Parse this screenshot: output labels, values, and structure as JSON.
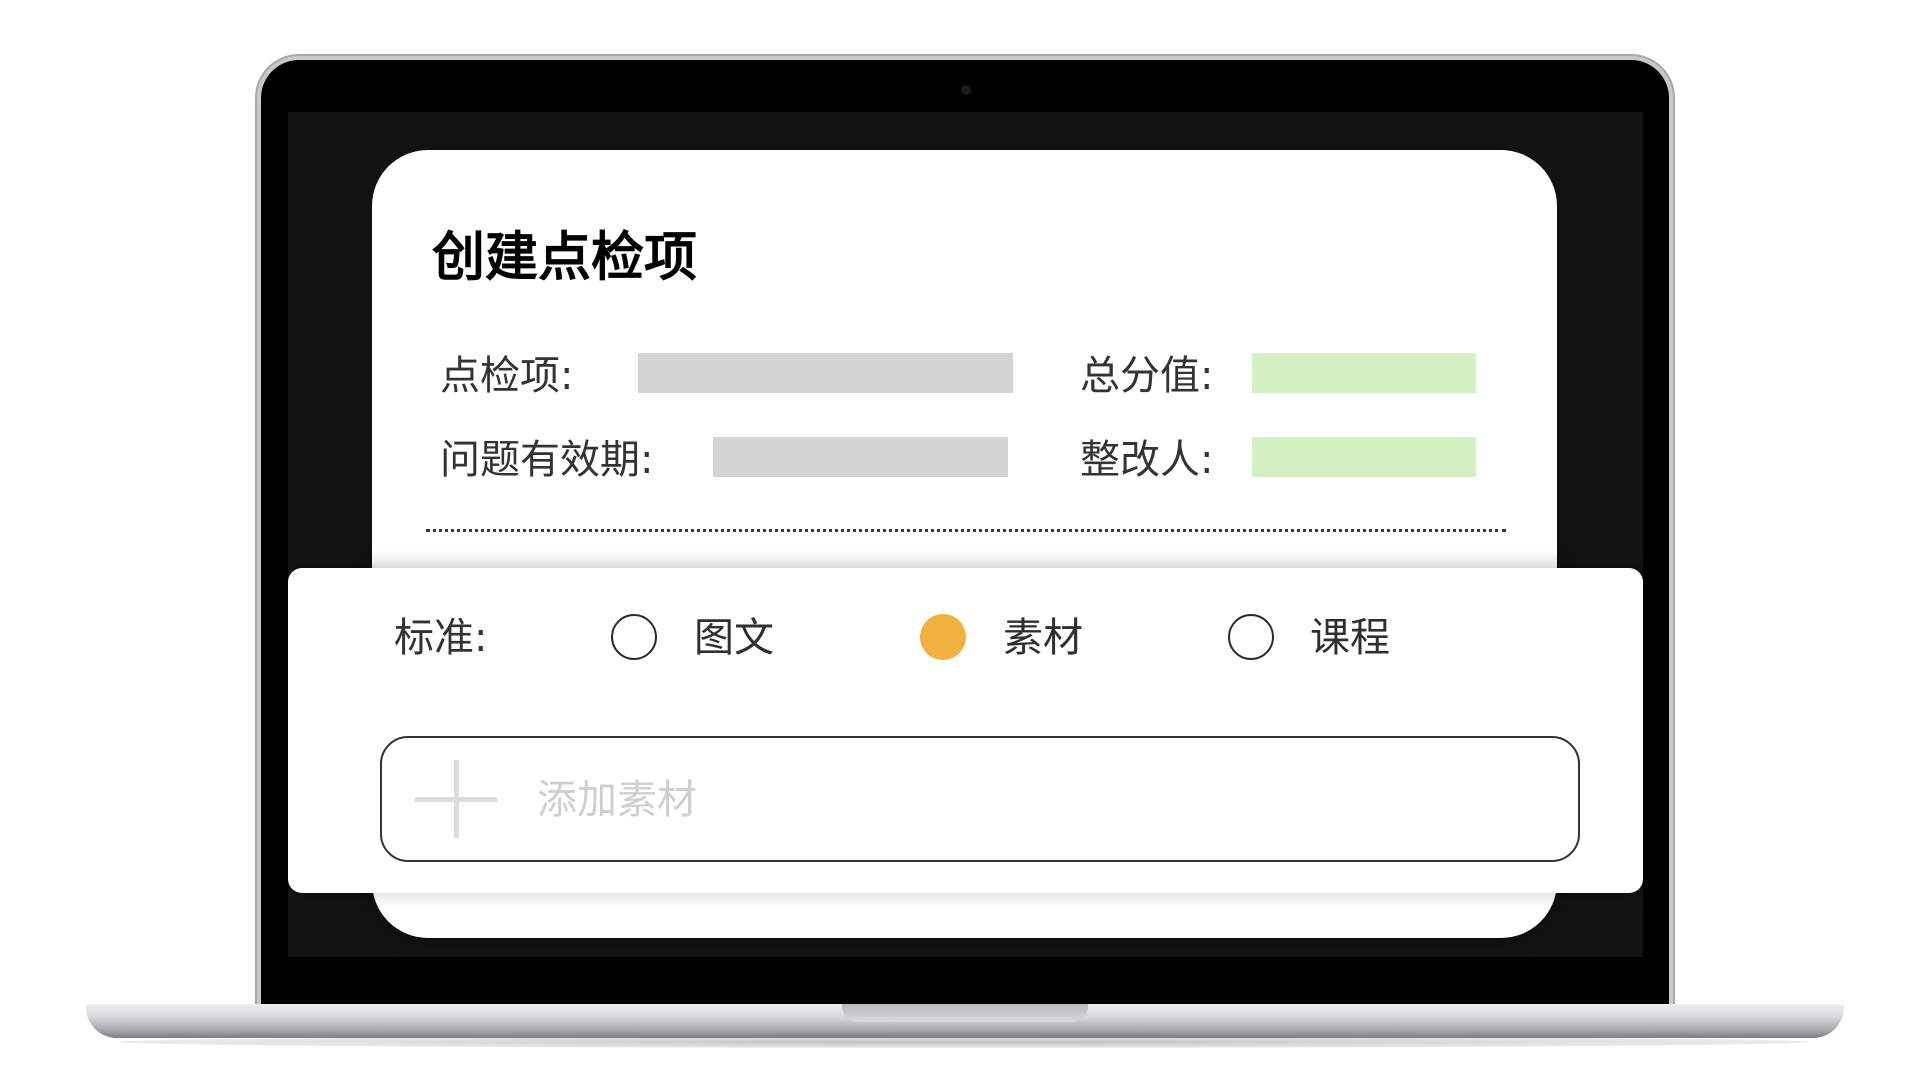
{
  "form": {
    "title": "创建点检项",
    "fields": {
      "check_item": "点检项:",
      "total_score": "总分值:",
      "validity": "问题有效期:",
      "rectifier": "整改人:"
    }
  },
  "standard": {
    "label": "标准:",
    "options": [
      "图文",
      "素材",
      "课程"
    ],
    "selected": "素材",
    "selected_color": "#f0b23d"
  },
  "add_material": {
    "placeholder": "添加素材",
    "icon": "plus-icon"
  },
  "colors": {
    "input_gray": "#d4d4d4",
    "input_green": "#d3f0c2"
  }
}
